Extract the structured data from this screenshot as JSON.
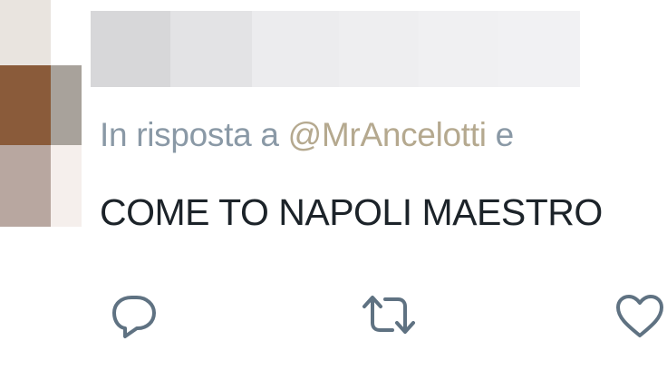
{
  "tweet": {
    "reply_prefix": "In risposta a",
    "mention": "@MrAncelotti",
    "reply_suffix": "e",
    "text": "COME TO NAPOLI MAESTRO"
  },
  "actions": {
    "reply_icon": "reply-icon",
    "retweet_icon": "retweet-icon",
    "like_icon": "heart-icon"
  },
  "colors": {
    "reply_line": "#8a99a6",
    "mention": "#b5a98f",
    "text": "#1c2329",
    "icons": "#5f7282"
  }
}
